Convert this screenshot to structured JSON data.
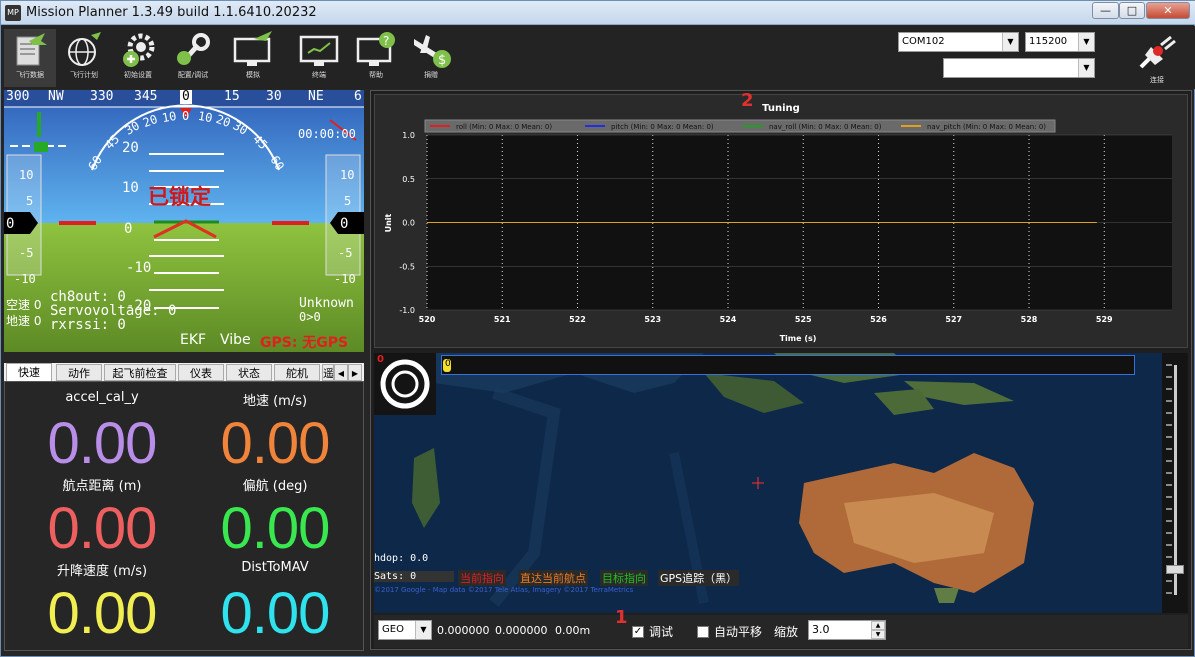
{
  "window": {
    "title": "Mission Planner 1.3.49 build 1.1.6410.20232",
    "icon_label": "MP",
    "min": "—",
    "max": "□",
    "close": "✕"
  },
  "toolbar": {
    "items": [
      {
        "label": "飞行数据",
        "icon": "flight-data-icon",
        "active": true
      },
      {
        "label": "飞行计划",
        "icon": "flight-plan-icon"
      },
      {
        "label": "初始设置",
        "icon": "initial-setup-icon"
      },
      {
        "label": "配置/调试",
        "icon": "config-tuning-icon"
      },
      {
        "label": "模拟",
        "icon": "simulation-icon"
      },
      {
        "label": "终端",
        "icon": "terminal-icon"
      },
      {
        "label": "帮助",
        "icon": "help-icon"
      },
      {
        "label": "捐赠",
        "icon": "donate-icon"
      }
    ],
    "com_port": "COM102",
    "baud": "115200",
    "profile": "",
    "connect_label": "连接"
  },
  "hud": {
    "heading_ticks": [
      "300",
      "NW",
      "330",
      "345",
      "0",
      "15",
      "30",
      "NE",
      "6"
    ],
    "heading_value": "0",
    "pitch_labels": [
      "20",
      "10",
      "0",
      "-10",
      "-20"
    ],
    "roll_labels": [
      "60",
      "45",
      "30",
      "20",
      "10",
      "0",
      "10",
      "20",
      "30",
      "45",
      "60"
    ],
    "speed_ticks": [
      "10",
      "5",
      "0",
      "-5",
      "-10"
    ],
    "alt_ticks": [
      "10",
      "5",
      "0",
      "-5",
      "-10"
    ],
    "speed_value": "0",
    "alt_value": "0",
    "armed_text": "已锁定",
    "time": "00:00:00",
    "airspeed_label": "空速 0",
    "groundspeed_label": "地速 0",
    "ch8out": "ch8out: 0",
    "servovoltage": "Servovoltage: 0",
    "rxrssi": "rxrssi: 0",
    "mode": "Unknown",
    "wp": "0>0",
    "ekf": "EKF",
    "vibe": "Vibe",
    "gps": "GPS: 无GPS",
    "sky_color": "#3f7fd8",
    "ground_color": "#7fae35"
  },
  "tabs": {
    "items": [
      "快速",
      "动作",
      "起飞前检查",
      "仪表",
      "状态",
      "舵机",
      "遥"
    ],
    "selected": 0
  },
  "quick": [
    {
      "label": "accel_cal_y",
      "value": "0.00",
      "color": "#b88ee8"
    },
    {
      "label": "地速 (m/s)",
      "value": "0.00",
      "color": "#f0843a"
    },
    {
      "label": "航点距离 (m)",
      "value": "0.00",
      "color": "#ee5f5f"
    },
    {
      "label": "偏航 (deg)",
      "value": "0.00",
      "color": "#39e84f"
    },
    {
      "label": "升降速度 (m/s)",
      "value": "0.00",
      "color": "#f1ee52"
    },
    {
      "label": "DistToMAV",
      "value": "0.00",
      "color": "#2ee3ee"
    }
  ],
  "annotations": {
    "n1": "1",
    "n2": "2"
  },
  "chart_data": {
    "type": "line",
    "title": "Tuning",
    "xlabel": "Time (s)",
    "ylabel": "Unit",
    "xlim": [
      520,
      529
    ],
    "ylim": [
      -1.0,
      1.0
    ],
    "xticks": [
      "520",
      "521",
      "522",
      "523",
      "524",
      "525",
      "526",
      "527",
      "528",
      "529"
    ],
    "yticks": [
      "1.0",
      "0.5",
      "0.0",
      "-0.5",
      "-1.0"
    ],
    "grid": true,
    "legend_position": "top",
    "series": [
      {
        "name": "roll (Min: 0 Max: 0 Mean: 0)",
        "color": "#e02020",
        "x": [
          520,
          528.9
        ],
        "y": [
          0,
          0
        ]
      },
      {
        "name": "pitch (Min: 0 Max: 0 Mean: 0)",
        "color": "#2030e0",
        "x": [
          520,
          528.9
        ],
        "y": [
          0,
          0
        ]
      },
      {
        "name": "nav_roll (Min: 0 Max: 0 Mean: 0)",
        "color": "#20a020",
        "x": [
          520,
          528.9
        ],
        "y": [
          0,
          0
        ]
      },
      {
        "name": "nav_pitch (Min: 0 Max: 0 Mean: 0)",
        "color": "#e0a020",
        "x": [
          520,
          528.9
        ],
        "y": [
          0,
          0
        ]
      }
    ]
  },
  "map": {
    "hdop": "hdop: 0.0",
    "sats": "Sats: 0",
    "legend": [
      {
        "label": "当前指向",
        "color": "#e02020"
      },
      {
        "label": "直达当前航点",
        "color": "#f07a20"
      },
      {
        "label": "目标指向",
        "color": "#20c020"
      },
      {
        "label": "GPS追踪（黑）",
        "color": "#ffffff"
      }
    ],
    "copyright": "©2017 Google - Map data ©2017 Tele Atlas, Imagery ©2017 TerraMetrics",
    "compass_value": "0",
    "progress_value": "0"
  },
  "status": {
    "coord_system": "GEO",
    "lat": "0.000000",
    "lng": "0.000000",
    "alt": "0.00m",
    "tuning_label": "调试",
    "tuning_checked": true,
    "autopan_label": "自动平移",
    "autopan_checked": false,
    "zoom_label": "缩放",
    "zoom_value": "3.0"
  }
}
